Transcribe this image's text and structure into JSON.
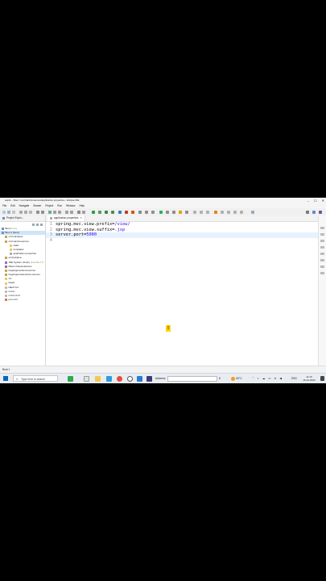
{
  "window": {
    "title": "sap1n - Boot / src/main/resources/application.properties - Eclipse IDE",
    "controls": [
      "–",
      "☐",
      "✕"
    ]
  },
  "menu": [
    "File",
    "Edit",
    "Navigate",
    "Search",
    "Project",
    "Run",
    "Window",
    "Help"
  ],
  "explorer": {
    "title": "Project Explo...",
    "items": [
      {
        "label": "Boot",
        "extra": "[boot]"
      },
      {
        "label": "Boot 1 [boot]"
      },
      {
        "label": "src/main/java"
      },
      {
        "label": "src/main/resources"
      },
      {
        "label": "static"
      },
      {
        "label": "templates"
      },
      {
        "label": "application.properties"
      },
      {
        "label": "src/test/java"
      },
      {
        "label": "JRE System Library",
        "extra": "[JavaSE-17]"
      },
      {
        "label": "Maven Dependencies"
      },
      {
        "label": "target/generated-sources"
      },
      {
        "label": "target/generated-test-sources"
      },
      {
        "label": "src"
      },
      {
        "label": "target"
      },
      {
        "label": "HELP.md"
      },
      {
        "label": "mvnw"
      },
      {
        "label": "mvnw.cmd"
      },
      {
        "label": "pom.xml"
      }
    ]
  },
  "editor": {
    "tab": "application.properties",
    "lines": [
      {
        "n": "1",
        "key": "spring.mvc.view.prefix",
        "eq": "=",
        "val": "/view/"
      },
      {
        "n": "2",
        "key": "spring.mvc.view.suffix",
        "eq": "=",
        "val": ".jsp"
      },
      {
        "n": "3",
        "key": "server.port",
        "eq": "=",
        "val": "5000"
      },
      {
        "n": "4",
        "key": "",
        "eq": "",
        "val": ""
      }
    ]
  },
  "cursor_glyph": "I",
  "status": "Boot 1",
  "taskbar": {
    "search_placeholder": "Type here to search",
    "address_label": "Address",
    "address_value": "6",
    "weather": "30°C",
    "lang": "ENG",
    "time": "11:16",
    "date": "16-10-2022"
  },
  "colors": {
    "value": "#2a00ff",
    "selection": "#cde6f7",
    "current_line": "#e8f2fe",
    "accent": "#0067c0"
  }
}
